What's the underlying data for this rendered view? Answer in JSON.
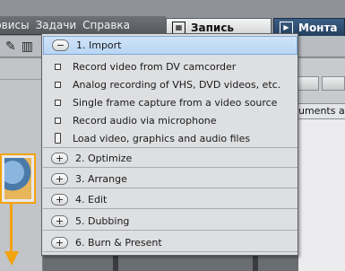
{
  "menubar": {
    "items": [
      "рвисы",
      "Задачи",
      "Справка"
    ]
  },
  "mode_tabs": {
    "record_label": "Запись",
    "edit_label": "Монта"
  },
  "right_panel": {
    "header_text": "uments a"
  },
  "dropdown": {
    "sections": [
      {
        "label": "1. Import",
        "toggle": "−",
        "expanded": true,
        "items": [
          "Record video from DV camcorder",
          "Analog recording of VHS, DVD videos, etc.",
          "Single frame capture from a video source",
          "Record audio via microphone",
          "Load video, graphics and audio files"
        ]
      },
      {
        "label": "2. Optimize",
        "toggle": "+"
      },
      {
        "label": "3. Arrange",
        "toggle": "+"
      },
      {
        "label": "4. Edit",
        "toggle": "+"
      },
      {
        "label": "5. Dubbing",
        "toggle": "+"
      },
      {
        "label": "6. Burn & Present",
        "toggle": "+"
      }
    ]
  },
  "colors": {
    "accent_orange": "#f3a30d",
    "active_section_bg": "#c4dcf5",
    "edit_tab_bg": "#2f4e73"
  }
}
